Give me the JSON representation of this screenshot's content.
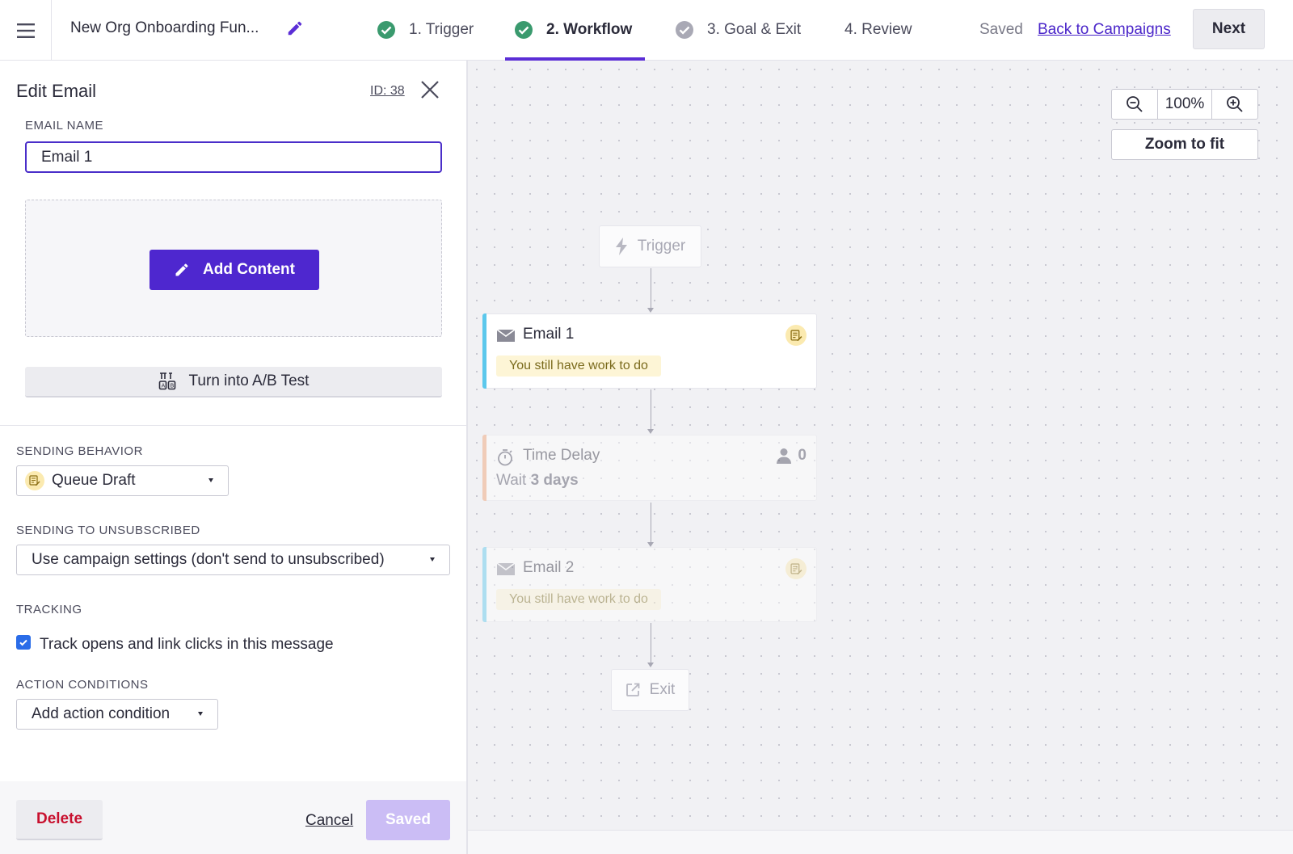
{
  "topbar": {
    "campaign_name": "New Org Onboarding Fun...",
    "steps": [
      {
        "label": "1. Trigger",
        "state": "complete"
      },
      {
        "label": "2. Workflow",
        "state": "active"
      },
      {
        "label": "3. Goal & Exit",
        "state": "incomplete"
      },
      {
        "label": "4. Review",
        "state": "none"
      }
    ],
    "saved_status": "Saved",
    "back_link": "Back to Campaigns",
    "next_label": "Next"
  },
  "panel": {
    "title": "Edit Email",
    "id_label": "ID: 38",
    "email_name_label": "EMAIL NAME",
    "email_name_value": "Email 1",
    "add_content_label": "Add Content",
    "ab_test_label": "Turn into A/B Test",
    "sending_behavior_label": "SENDING BEHAVIOR",
    "sending_behavior_value": "Queue Draft",
    "unsubscribed_label": "SENDING TO UNSUBSCRIBED",
    "unsubscribed_value": "Use campaign settings (don't send to unsubscribed)",
    "tracking_label": "TRACKING",
    "tracking_checkbox_label": "Track opens and link clicks in this message",
    "tracking_checked": true,
    "action_conditions_label": "ACTION CONDITIONS",
    "action_condition_select": "Add action condition",
    "delete_label": "Delete",
    "cancel_label": "Cancel",
    "saved_label": "Saved"
  },
  "canvas": {
    "zoom_level": "100%",
    "zoom_fit_label": "Zoom to fit",
    "trigger_label": "Trigger",
    "email1_title": "Email 1",
    "email1_status": "You still have work to do",
    "delay_title": "Time Delay",
    "delay_wait": "Wait",
    "delay_duration": "3 days",
    "delay_count": "0",
    "email2_title": "Email 2",
    "email2_status": "You still have work to do",
    "exit_label": "Exit"
  },
  "colors": {
    "primary": "#4e27cf",
    "accent_email": "#5cc8ec",
    "accent_delay": "#f0a070",
    "complete_check": "#3a9a6e",
    "delete": "#c8102e"
  },
  "icons": [
    "menu-icon",
    "pencil-icon",
    "check-circle-icon",
    "close-icon",
    "ab-test-icon",
    "queue-draft-icon",
    "zoom-out-icon",
    "zoom-in-icon",
    "lightning-icon",
    "envelope-icon",
    "stopwatch-icon",
    "person-icon",
    "exit-icon"
  ]
}
